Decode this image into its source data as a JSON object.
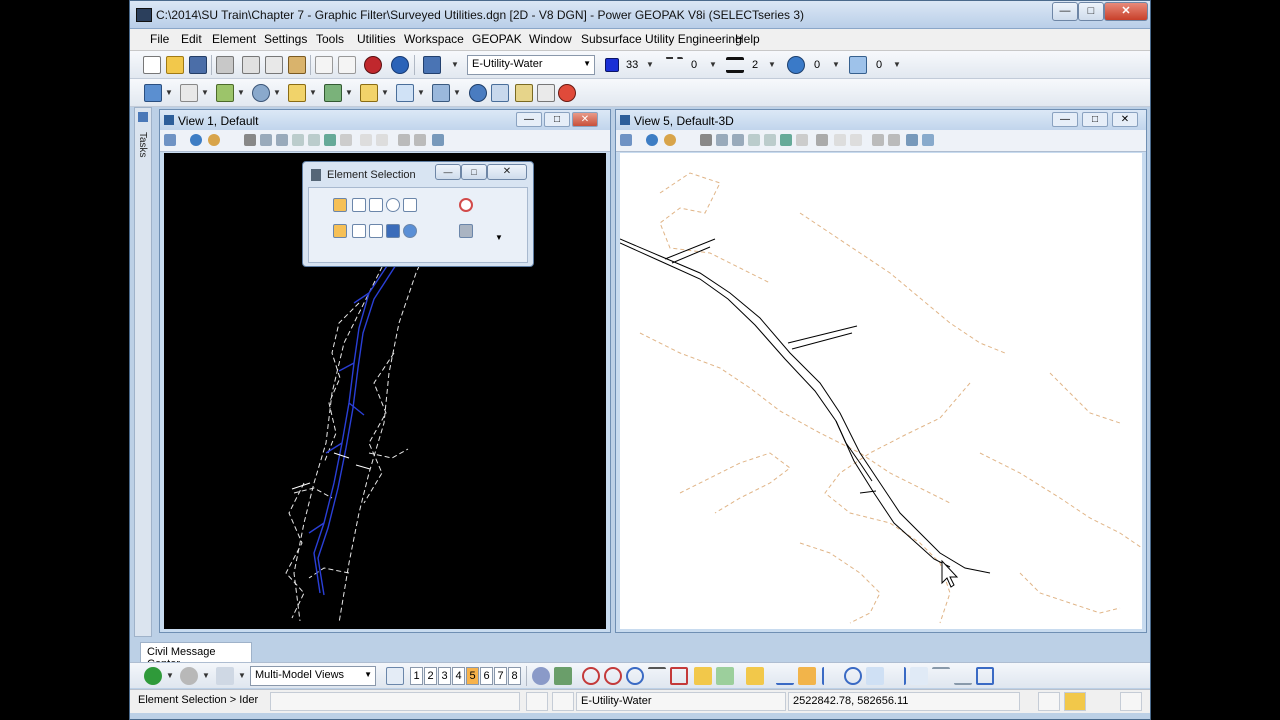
{
  "window": {
    "title": "C:\\2014\\SU Train\\Chapter 7 - Graphic Filter\\Surveyed Utilities.dgn [2D - V8 DGN] - Power GEOPAK V8i (SELECTseries 3)"
  },
  "menu": [
    "File",
    "Edit",
    "Element",
    "Settings",
    "Tools",
    "Utilities",
    "Workspace",
    "GEOPAK",
    "Window",
    "Subsurface Utility Engineering",
    "Help"
  ],
  "attributes": {
    "level": "E-Utility-Water",
    "color_value": "33",
    "linestyle_value": "0",
    "weight_value": "2",
    "transparency_value": "0",
    "priority_value": "0"
  },
  "tasks_label": "Tasks",
  "view1": {
    "title": "View 1, Default"
  },
  "view5": {
    "title": "View 5, Default-3D"
  },
  "element_selection": {
    "title": "Element Selection"
  },
  "message_center": {
    "tab": "Civil Message Center"
  },
  "bottom_toolbar": {
    "model_views": "Multi-Model Views",
    "view_numbers": [
      "1",
      "2",
      "3",
      "4",
      "5",
      "6",
      "7",
      "8"
    ],
    "active_view": "5"
  },
  "status": {
    "prompt": "Element Selection > Ider",
    "active_level": "E-Utility-Water",
    "coordinates": "2522842.78, 582656.11"
  },
  "colors": {
    "active_color": "#1a2fd6",
    "view1_background": "#000000",
    "view5_background": "#ffffff",
    "terrain_dashed": "#e0b486",
    "water_line_2d": "#2a3fd6"
  }
}
